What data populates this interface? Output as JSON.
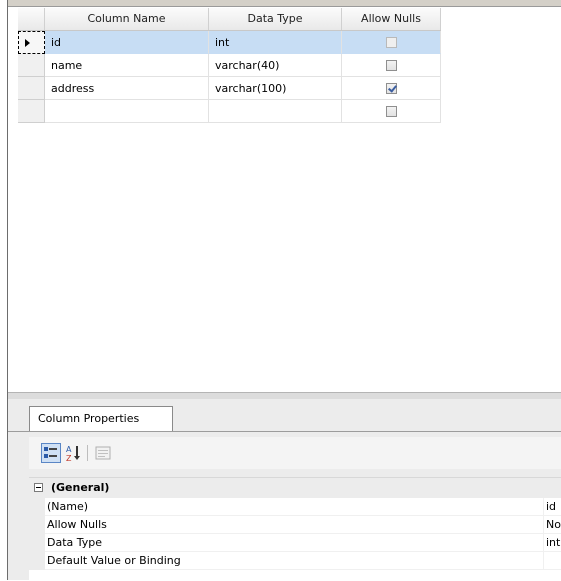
{
  "grid": {
    "columns": [
      "Column Name",
      "Data Type",
      "Allow Nulls"
    ],
    "rows": [
      {
        "name": "id",
        "type": "int",
        "allow_nulls": false,
        "active": true
      },
      {
        "name": "name",
        "type": "varchar(40)",
        "allow_nulls": false,
        "active": false
      },
      {
        "name": "address",
        "type": "varchar(100)",
        "allow_nulls": true,
        "active": false
      },
      {
        "name": "",
        "type": "",
        "allow_nulls": false,
        "active": false
      }
    ]
  },
  "properties": {
    "tab_label": "Column Properties",
    "toolbar": {
      "categorized": "categorized-icon",
      "alphabetical": "sort-alphabetical-icon",
      "pages": "property-pages-icon"
    },
    "category": "(General)",
    "items": [
      {
        "name": "(Name)",
        "value": "id"
      },
      {
        "name": "Allow Nulls",
        "value": "No"
      },
      {
        "name": "Data Type",
        "value": "int"
      },
      {
        "name": "Default Value or Binding",
        "value": ""
      }
    ]
  },
  "colors": {
    "selection": "#c7ddf4",
    "panel": "#ececec",
    "check": "#3b5ea0"
  }
}
